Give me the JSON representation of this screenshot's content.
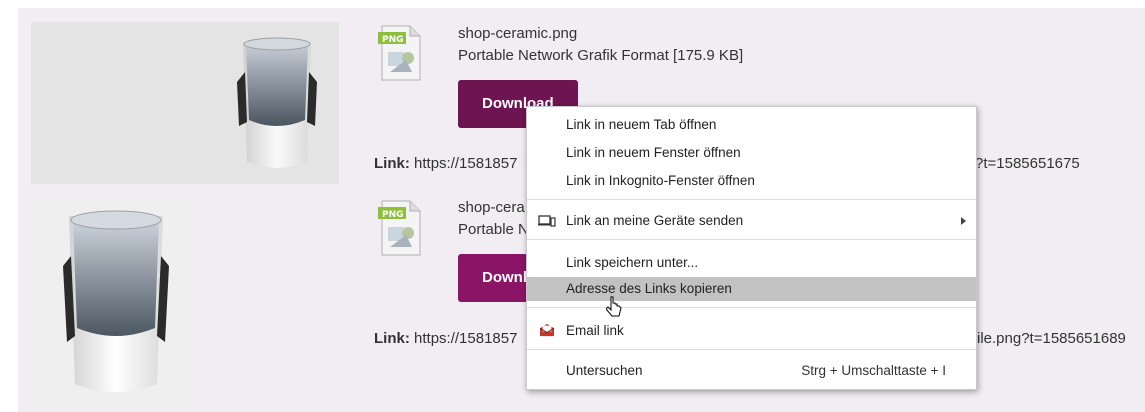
{
  "files": [
    {
      "name": "shop-ceramic.png",
      "description": "Portable Network Grafik Format [175.9 KB]",
      "button_label": "Download",
      "link_label": "Link:",
      "link_start": "https://1581857",
      "link_end": "?t=1585651675",
      "icon_text": "PNG"
    },
    {
      "name": "shop-cera",
      "description": "Portable N",
      "button_label": "Downl",
      "link_label": "Link:",
      "link_start": "https://1581857",
      "link_end": "ile.png?t=1585651689",
      "icon_text": "PNG"
    }
  ],
  "context_menu": {
    "items": [
      {
        "label": "Link in neuem Tab öffnen"
      },
      {
        "label": "Link in neuem Fenster öffnen"
      },
      {
        "label": "Link in Inkognito-Fenster öffnen"
      },
      {
        "label": "Link an meine Geräte senden",
        "icon": "devices-icon",
        "submenu": true
      },
      {
        "label": "Link speichern unter..."
      },
      {
        "label": "Adresse des Links kopieren",
        "highlighted": true
      },
      {
        "label": "Email link",
        "icon": "email-icon"
      },
      {
        "label": "Untersuchen",
        "shortcut": "Strg + Umschalttaste + I"
      }
    ]
  },
  "colors": {
    "panel_bg": "#f1edf2",
    "button_bg": "#6e1551",
    "menu_highlight": "#c2c2c2",
    "icon_badge": "#8dbf3c"
  }
}
